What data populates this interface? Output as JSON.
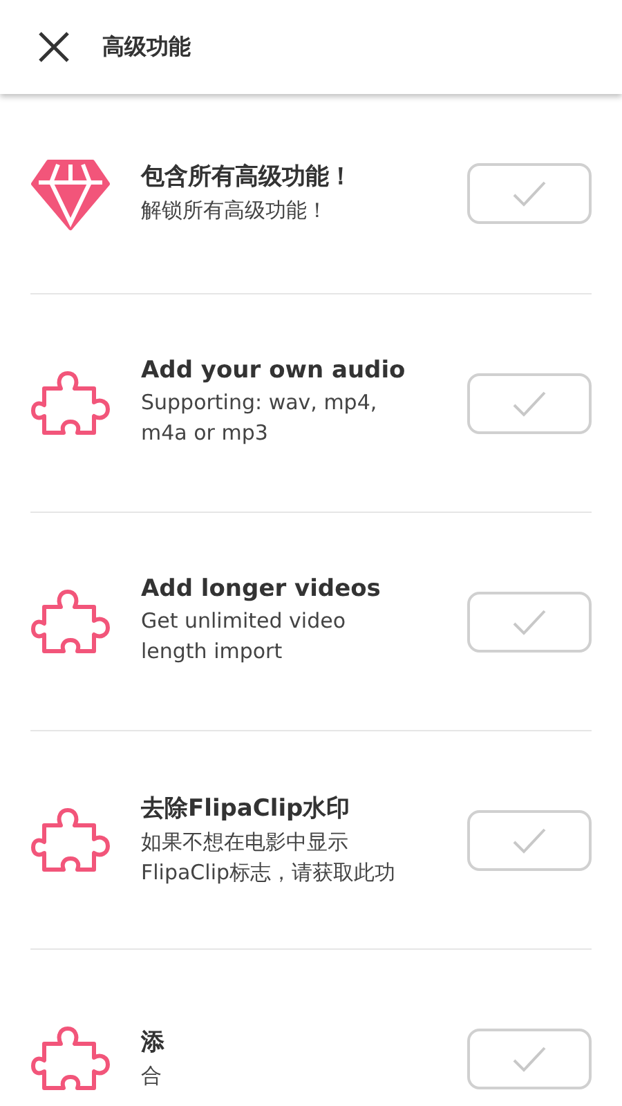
{
  "header": {
    "title": "高级功能"
  },
  "features": [
    {
      "kind": "diamond",
      "title": "包含所有高级功能！",
      "subtitle": "解锁所有高级功能！",
      "checked": false
    },
    {
      "kind": "puzzle",
      "title": "Add your own audio",
      "subtitle": "Supporting: wav, mp4, m4a or mp3",
      "checked": false
    },
    {
      "kind": "puzzle",
      "title": "Add longer videos",
      "subtitle": "Get unlimited video length import",
      "checked": false
    },
    {
      "kind": "puzzle",
      "title": "去除FlipaClip水印",
      "subtitle": "如果不想在电影中显示FlipaClip标志，请获取此功",
      "checked": false
    },
    {
      "kind": "puzzle",
      "title": "添",
      "subtitle": "合",
      "checked": false
    }
  ]
}
